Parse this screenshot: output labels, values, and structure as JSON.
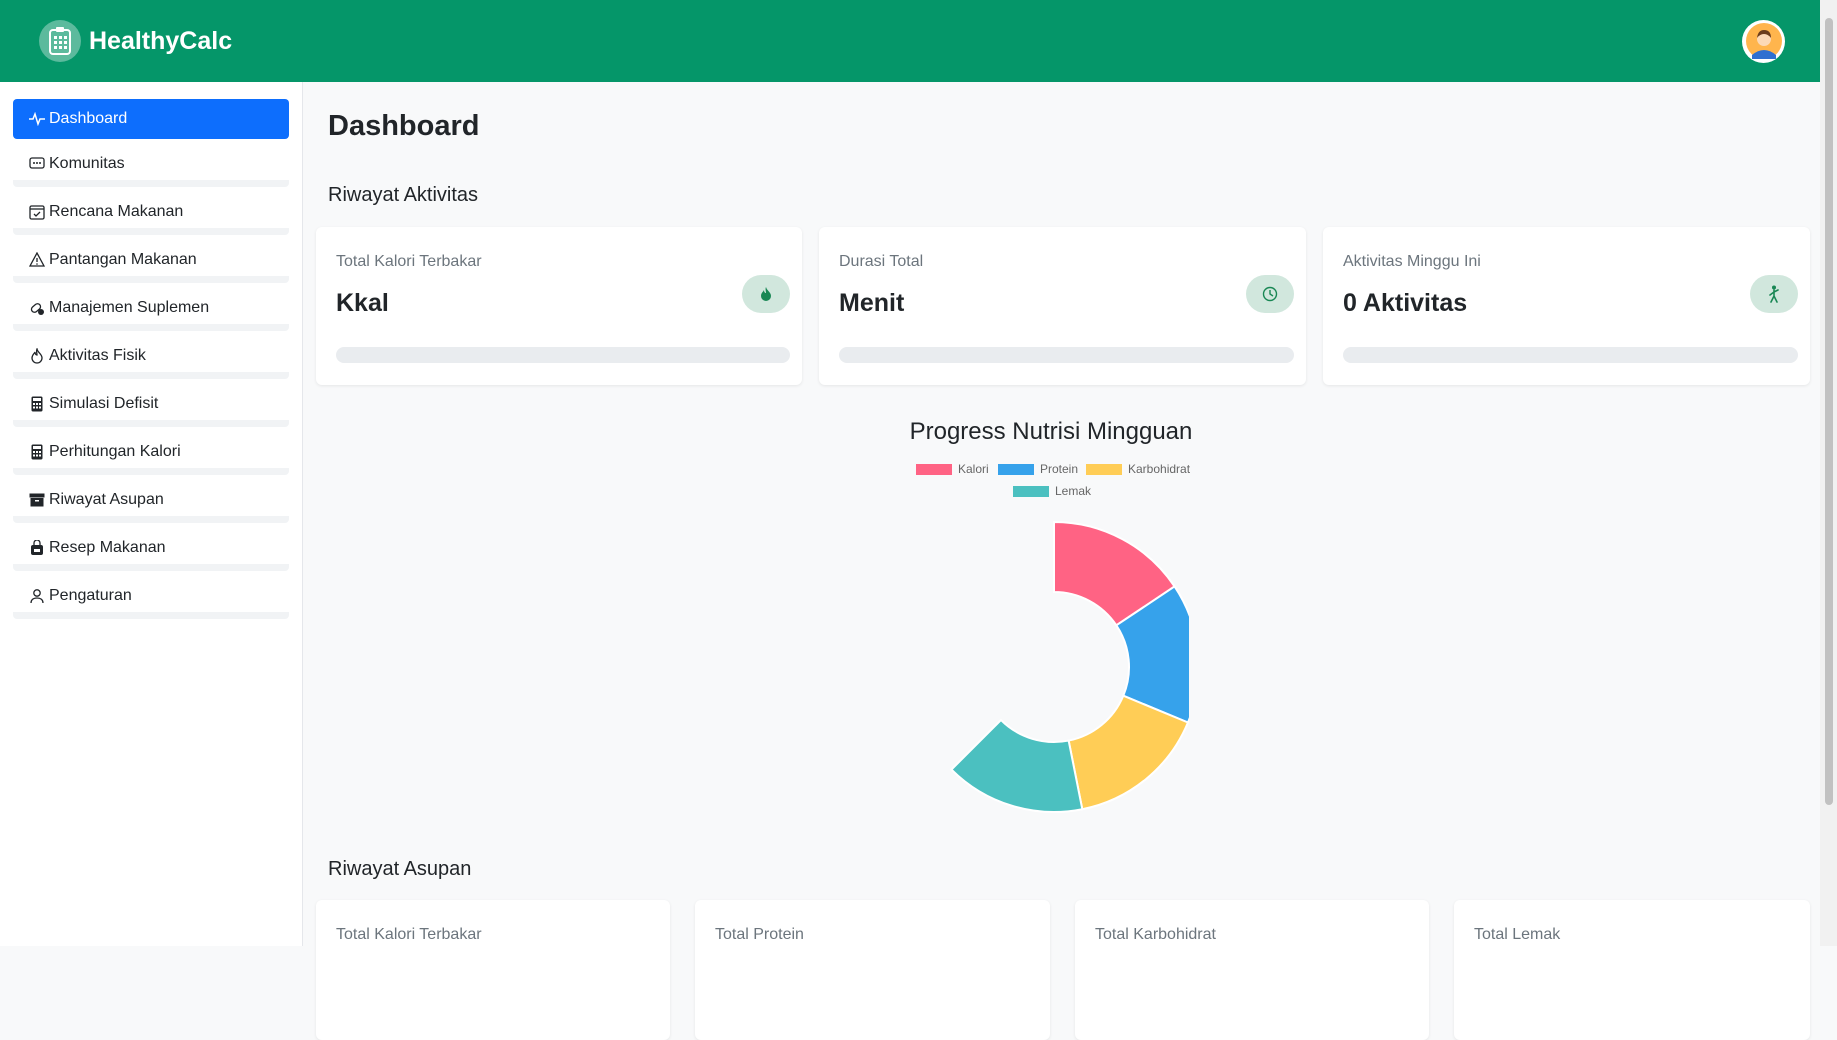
{
  "app": {
    "name": "HealthyCalc"
  },
  "sidebar": {
    "items": [
      {
        "label": "Dashboard",
        "icon": "activity-icon",
        "active": true
      },
      {
        "label": "Komunitas",
        "icon": "chat-icon"
      },
      {
        "label": "Rencana Makanan",
        "icon": "calendar-check-icon"
      },
      {
        "label": "Pantangan Makanan",
        "icon": "warning-icon"
      },
      {
        "label": "Manajemen Suplemen",
        "icon": "capsule-icon"
      },
      {
        "label": "Aktivitas Fisik",
        "icon": "fire-icon"
      },
      {
        "label": "Simulasi Defisit",
        "icon": "calculator-icon"
      },
      {
        "label": "Perhitungan Kalori",
        "icon": "calculator-icon"
      },
      {
        "label": "Riwayat Asupan",
        "icon": "archive-icon"
      },
      {
        "label": "Resep Makanan",
        "icon": "bag-icon"
      },
      {
        "label": "Pengaturan",
        "icon": "person-icon"
      }
    ]
  },
  "main": {
    "title": "Dashboard",
    "activity_section": {
      "title": "Riwayat Aktivitas",
      "cards": [
        {
          "label": "Total Kalori Terbakar",
          "value": "Kkal",
          "icon": "fire-icon"
        },
        {
          "label": "Durasi Total",
          "value": "Menit",
          "icon": "clock-icon"
        },
        {
          "label": "Aktivitas Minggu Ini",
          "value": "0 Aktivitas",
          "icon": "person-walking-icon"
        }
      ]
    },
    "intake_section": {
      "title": "Riwayat Asupan",
      "cards": [
        {
          "label": "Total Kalori Terbakar"
        },
        {
          "label": "Total Protein"
        },
        {
          "label": "Total Karbohidrat"
        },
        {
          "label": "Total Lemak"
        }
      ]
    }
  },
  "chart_data": {
    "type": "pie",
    "title": "Progress Nutrisi Mingguan",
    "categories": [
      "Kalori",
      "Protein",
      "Karbohidrat",
      "Lemak"
    ],
    "values": [
      25,
      25,
      25,
      25
    ],
    "colors": [
      "#ff6384",
      "#36a2eb",
      "#ffcd56",
      "#4bc0c0"
    ],
    "legend": "top"
  },
  "colors": {
    "brand": "#059669",
    "active_nav": "#0d6efd",
    "icon_bg": "#d1e7dd",
    "icon_fg": "#198754"
  }
}
